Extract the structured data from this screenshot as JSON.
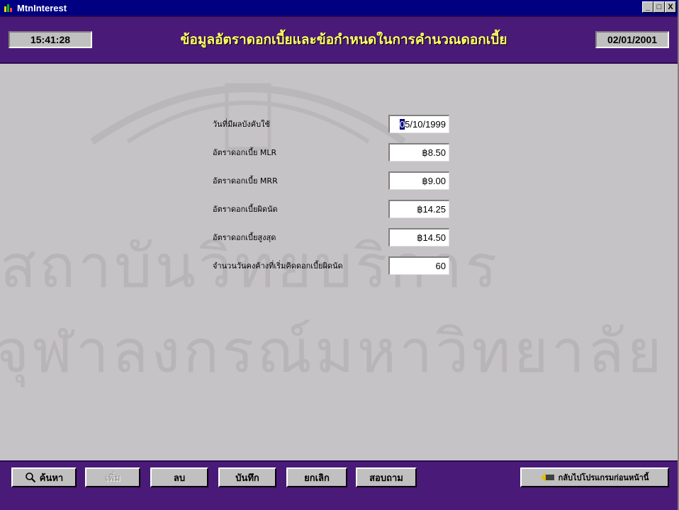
{
  "window": {
    "title": "MtnInterest",
    "controls": {
      "minimize": "_",
      "maximize": "□",
      "close": "X"
    }
  },
  "header": {
    "time": "15:41:28",
    "title": "ข้อมูลอัตราดอกเบี้ยและข้อกำหนดในการคำนวณดอกเบี้ย",
    "date": "02/01/2001"
  },
  "watermark": {
    "line1": "สถาบันวิทยบริการ",
    "line2": "จุฬาลงกรณ์มหาวิทยาลัย"
  },
  "form": {
    "fields": [
      {
        "label": "วันที่มีผลบังคับใช้",
        "value_first": "0",
        "value_rest": "5/10/1999"
      },
      {
        "label": "อัตราดอกเบี้ย MLR",
        "value": "฿8.50"
      },
      {
        "label": "อัตราดอกเบี้ย MRR",
        "value": "฿9.00"
      },
      {
        "label": "อัตราดอกเบี้ยผิดนัด",
        "value": "฿14.25"
      },
      {
        "label": "อัตราดอกเบี้ยสูงสุด",
        "value": "฿14.50"
      },
      {
        "label": "จำนวนวันคงค้างที่เริ่มคิดดอกเบี้ยผิดนัด",
        "value": "60"
      }
    ]
  },
  "toolbar": {
    "search": "ค้นหา",
    "add": "เพิ่ม",
    "delete": "ลบ",
    "save": "บันทึก",
    "cancel": "ยกเลิก",
    "query": "สอบถาม",
    "back": "กลับไปโปรแกรมก่อนหน้านี้"
  },
  "colors": {
    "header_bg": "#4a1a78",
    "title_text": "#ffff66",
    "titlebar": "#000080",
    "window_bg": "#c6c3c6"
  },
  "icons": [
    "app-icon",
    "magnifier-icon",
    "back-arrow-icon"
  ]
}
